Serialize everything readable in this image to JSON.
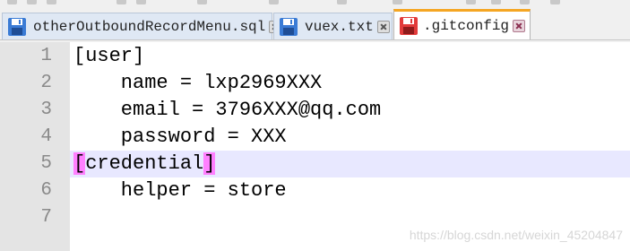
{
  "tabs": [
    {
      "label": "otherOutboundRecordMenu.sql",
      "icon": "floppy-disk-icon",
      "state": "saved",
      "active": false
    },
    {
      "label": "vuex.txt",
      "icon": "floppy-disk-icon",
      "state": "saved",
      "active": false
    },
    {
      "label": ".gitconfig",
      "icon": "floppy-disk-icon",
      "state": "unsaved",
      "active": true
    }
  ],
  "editor": {
    "line_numbers": [
      "1",
      "2",
      "3",
      "4",
      "5",
      "6",
      "7"
    ],
    "lines": [
      "[user]",
      "    name = lxp2969XXX",
      "    email = 3796XXX@qq.com",
      "    password = XXX",
      "[credential]",
      "    helper = store",
      ""
    ],
    "current_line": 5,
    "credential_open": "[",
    "credential_word": "credential",
    "credential_close": "]"
  },
  "watermark": "https://blog.csdn.net/weixin_45204847",
  "colors": {
    "saved_icon": "#3a7bd5",
    "unsaved_icon": "#e23b3b",
    "active_tab_accent": "#f5a623",
    "bracket_highlight": "#ff80ff",
    "current_line": "#e8e8ff",
    "gutter": "#e4e4e4"
  }
}
